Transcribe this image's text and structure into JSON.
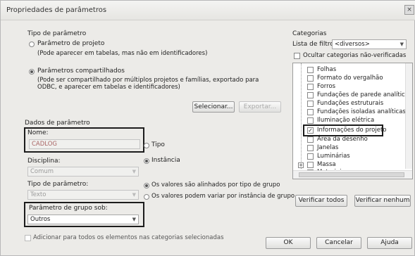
{
  "window": {
    "title": "Propriedades de parâmetros",
    "close_glyph": "×"
  },
  "param_type": {
    "heading": "Tipo de parâmetro",
    "project_label": "Parâmetro de projeto",
    "project_desc": "(Pode aparecer em tabelas, mas não em identificadores)",
    "shared_label": "Parâmetros compartilhados",
    "shared_desc_line1": "(Pode ser compartilhado por múltiplos projetos e famílias, exportado para",
    "shared_desc_line2": "ODBC, e aparecer em tabelas e identificadores)",
    "select_button": "Selecionar...",
    "export_button": "Exportar..."
  },
  "param_data": {
    "heading": "Dados de parâmetro",
    "name_label": "Nome:",
    "name_value": "CADLOG",
    "type_radio": "Tipo",
    "instance_radio": "Instância",
    "discipline_label": "Disciplina:",
    "discipline_value": "Comum",
    "param_type_label": "Tipo de parâmetro:",
    "param_type_value": "Texto",
    "aligned_label": "Os valores são alinhados por tipo de grupo",
    "vary_label": "Os valores podem variar por instância de grupo",
    "group_label": "Parâmetro de grupo sob:",
    "group_value": "Outros",
    "add_all_label": "Adicionar para todos os elementos nas categorias selecionadas"
  },
  "categories": {
    "heading": "Categorias",
    "filter_label": "Lista de filtros:",
    "filter_value": "<diversos>",
    "hide_unchecked": "Ocultar categorias não-verificadas",
    "items": [
      {
        "label": "Folhas",
        "checked": false
      },
      {
        "label": "Formato do vergalhão",
        "checked": false
      },
      {
        "label": "Forros",
        "checked": false
      },
      {
        "label": "Fundações de parede analític",
        "checked": false
      },
      {
        "label": "Fundações estruturais",
        "checked": false
      },
      {
        "label": "Fundações isoladas analíticas",
        "checked": false
      },
      {
        "label": "Iluminação elétrica",
        "checked": false
      },
      {
        "label": "Informações do projeto",
        "checked": true
      },
      {
        "label": "Área da desenho",
        "checked": false
      },
      {
        "label": "Janelas",
        "checked": false
      },
      {
        "label": "Luminárias",
        "checked": false
      },
      {
        "label": "Massa",
        "checked": false
      },
      {
        "label": "Materiais",
        "checked": false
      }
    ],
    "check_all": "Verificar todos",
    "check_none": "Verificar nenhum"
  },
  "footer": {
    "ok": "OK",
    "cancel": "Cancelar",
    "help": "Ajuda"
  }
}
